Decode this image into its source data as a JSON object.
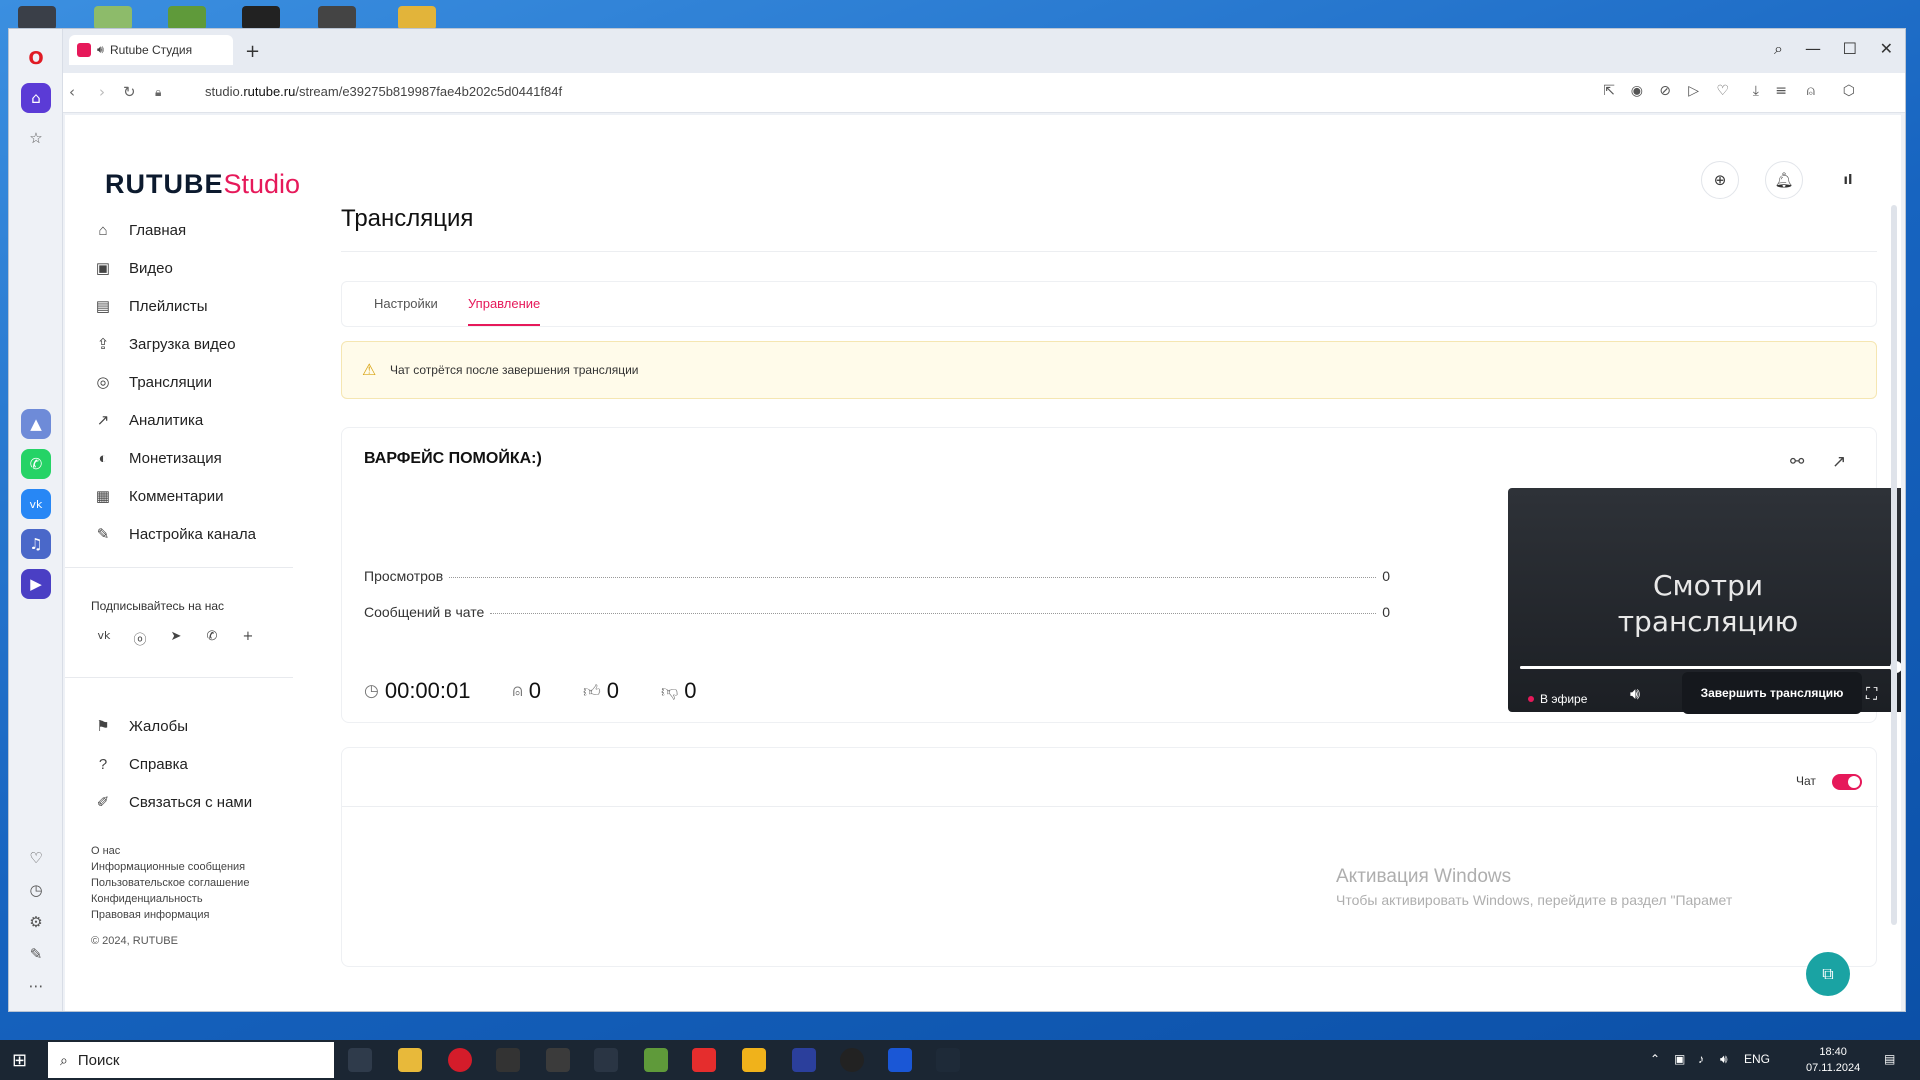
{
  "browser": {
    "tab_title": "Rutube Студия",
    "url_prefix": "studio.",
    "url_domain": "rutube.ru",
    "url_path": "/stream/e39275b819987fae4b202c5d0441f84f"
  },
  "logo": {
    "brand": "RUTUBE",
    "suffix": "Studio"
  },
  "sidebar": {
    "items": [
      {
        "label": "Главная",
        "icon": "home-icon"
      },
      {
        "label": "Видео",
        "icon": "video-icon"
      },
      {
        "label": "Плейлисты",
        "icon": "playlist-icon"
      },
      {
        "label": "Загрузка видео",
        "icon": "upload-icon"
      },
      {
        "label": "Трансляции",
        "icon": "broadcast-icon"
      },
      {
        "label": "Аналитика",
        "icon": "analytics-icon"
      },
      {
        "label": "Монетизация",
        "icon": "monetization-icon"
      },
      {
        "label": "Комментарии",
        "icon": "comments-icon"
      },
      {
        "label": "Настройка канала",
        "icon": "channel-settings-icon"
      }
    ],
    "follow_label": "Подписывайтесь на нас",
    "support_items": [
      {
        "label": "Жалобы",
        "icon": "flag-icon"
      },
      {
        "label": "Справка",
        "icon": "help-icon"
      },
      {
        "label": "Связаться с нами",
        "icon": "contact-icon"
      }
    ],
    "footer_links": [
      "О нас",
      "Информационные сообщения",
      "Пользовательское соглашение",
      "Конфиденциальность",
      "Правовая информация"
    ],
    "copyright": "© 2024, RUTUBE"
  },
  "main": {
    "title": "Трансляция",
    "tabs": [
      {
        "label": "Настройки",
        "active": false
      },
      {
        "label": "Управление",
        "active": true
      }
    ],
    "alert": "Чат сотрётся после завершения трансляции",
    "stream": {
      "name": "ВАРФЕЙС ПОМОЙКА:)",
      "stats": [
        {
          "label": "Просмотров",
          "value": "0"
        },
        {
          "label": "Сообщений в чате",
          "value": "0"
        }
      ],
      "duration": "00:00:01",
      "viewers": "0",
      "likes": "0",
      "dislikes": "0",
      "player_text_line1": "Смотри",
      "player_text_line2": "трансляцию",
      "live_label": "В эфире",
      "end_button": "Завершить трансляцию"
    },
    "chat": {
      "label": "Чат",
      "enabled": true
    }
  },
  "watermark": {
    "line1": "Активация Windows",
    "line2": "Чтобы активировать Windows, перейдите в раздел \"Парамет"
  },
  "taskbar": {
    "search_label": "Поиск",
    "lang": "ENG",
    "time": "18:40",
    "date": "07.11.2024"
  },
  "colors": {
    "accent": "#e6195a",
    "dark_button": "#15181d"
  }
}
